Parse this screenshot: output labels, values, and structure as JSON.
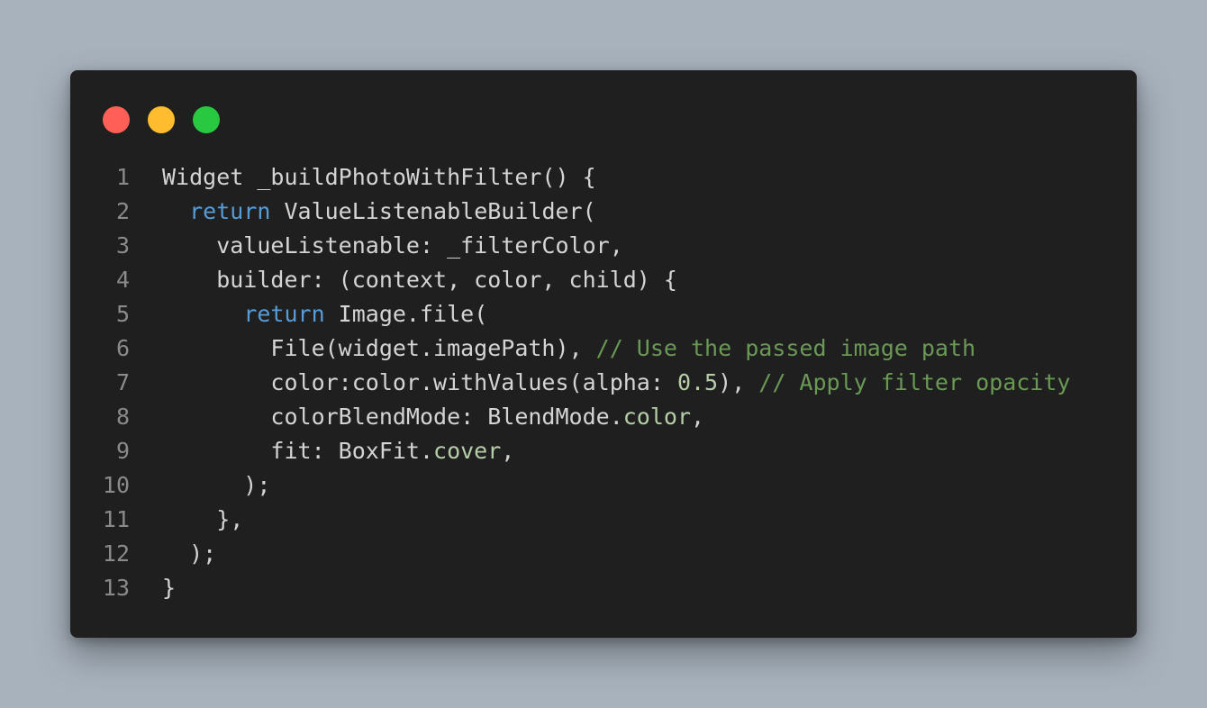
{
  "window": {
    "dots": [
      {
        "name": "close",
        "color": "#ff5f57"
      },
      {
        "name": "minimize",
        "color": "#febc2e"
      },
      {
        "name": "maximize",
        "color": "#28c840"
      }
    ]
  },
  "colors": {
    "background": "#a8b2bd",
    "editor": "#1f1f1f",
    "text": "#d4d4d4",
    "keyword": "#569cd6",
    "comment": "#6a9955",
    "number": "#b5cea8",
    "line_number": "#8a8a8a"
  },
  "code": {
    "lines": [
      {
        "number": "1",
        "tokens": [
          {
            "t": "Widget _buildPhotoWithFilter() {",
            "c": "tx"
          }
        ]
      },
      {
        "number": "2",
        "tokens": [
          {
            "t": "  ",
            "c": "tx"
          },
          {
            "t": "return",
            "c": "kw"
          },
          {
            "t": " ValueListenableBuilder(",
            "c": "tx"
          }
        ]
      },
      {
        "number": "3",
        "tokens": [
          {
            "t": "    valueListenable: _filterColor,",
            "c": "tx"
          }
        ]
      },
      {
        "number": "4",
        "tokens": [
          {
            "t": "    builder: (context, color, child) {",
            "c": "tx"
          }
        ]
      },
      {
        "number": "5",
        "tokens": [
          {
            "t": "      ",
            "c": "tx"
          },
          {
            "t": "return",
            "c": "kw"
          },
          {
            "t": " Image.file(",
            "c": "tx"
          }
        ]
      },
      {
        "number": "6",
        "tokens": [
          {
            "t": "        File(widget.imagePath), ",
            "c": "tx"
          },
          {
            "t": "// Use the passed image path",
            "c": "cm"
          }
        ]
      },
      {
        "number": "7",
        "tokens": [
          {
            "t": "        color:color.withValues(alpha: ",
            "c": "tx"
          },
          {
            "t": "0.5",
            "c": "num"
          },
          {
            "t": "), ",
            "c": "tx"
          },
          {
            "t": "// Apply filter opacity",
            "c": "cm"
          }
        ]
      },
      {
        "number": "8",
        "tokens": [
          {
            "t": "        colorBlendMode: BlendMode.",
            "c": "tx"
          },
          {
            "t": "color",
            "c": "prop"
          },
          {
            "t": ",",
            "c": "tx"
          }
        ]
      },
      {
        "number": "9",
        "tokens": [
          {
            "t": "        fit: BoxFit.",
            "c": "tx"
          },
          {
            "t": "cover",
            "c": "prop"
          },
          {
            "t": ",",
            "c": "tx"
          }
        ]
      },
      {
        "number": "10",
        "tokens": [
          {
            "t": "      );",
            "c": "tx"
          }
        ]
      },
      {
        "number": "11",
        "tokens": [
          {
            "t": "    },",
            "c": "tx"
          }
        ]
      },
      {
        "number": "12",
        "tokens": [
          {
            "t": "  );",
            "c": "tx"
          }
        ]
      },
      {
        "number": "13",
        "tokens": [
          {
            "t": "}",
            "c": "tx"
          }
        ]
      }
    ]
  }
}
